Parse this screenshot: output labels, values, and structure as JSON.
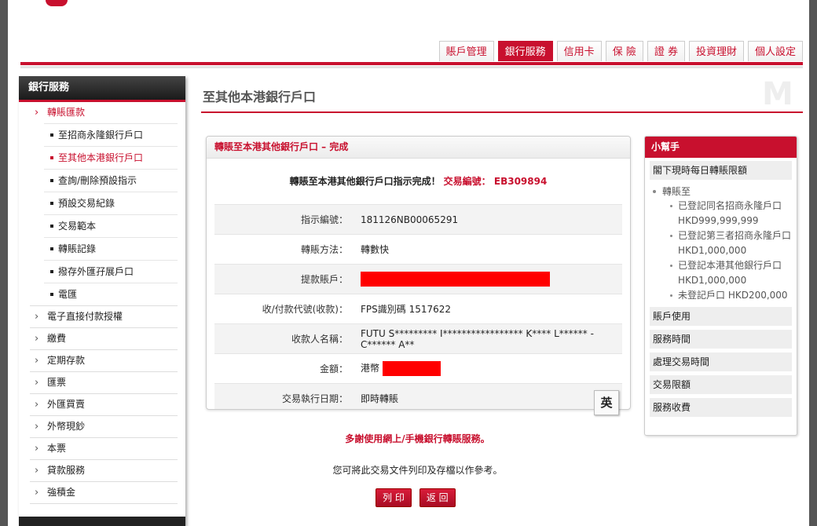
{
  "tabs": [
    "賬戶管理",
    "銀行服務",
    "信用卡",
    "保 險",
    "證 券",
    "投資理財",
    "個人設定"
  ],
  "sidebar": {
    "title": "銀行服務",
    "items": [
      {
        "label": "轉賬匯款",
        "sub": [
          "至招商永隆銀行戶口",
          "至其他本港銀行戶口",
          "查詢/刪除預設指示",
          "預設交易紀錄",
          "交易範本",
          "轉賬記錄",
          "撥存外匯孖展戶口",
          "電匯"
        ]
      },
      {
        "label": "電子直接付款授權"
      },
      {
        "label": "繳費"
      },
      {
        "label": "定期存款"
      },
      {
        "label": "匯票"
      },
      {
        "label": "外匯買賣"
      },
      {
        "label": "外幣現鈔"
      },
      {
        "label": "本票"
      },
      {
        "label": "貸款服務"
      },
      {
        "label": "強積金"
      }
    ]
  },
  "page_title": "至其他本港銀行戶口",
  "panel": {
    "title": "轉賬至本港其他銀行戶口 – 完成",
    "confirm_text": "轉賬至本港其他銀行戶口指示完成！",
    "ref_label": "交易編號：",
    "ref_value": "EB309894",
    "rows": [
      {
        "label": "指示編號：",
        "value": "181126NB00065291"
      },
      {
        "label": "轉賬方法：",
        "value": "轉數快"
      },
      {
        "label": "提款賬戶：",
        "value": ""
      },
      {
        "label": "收/付款代號(收款)：",
        "value": "FPS識別碼 1517622"
      },
      {
        "label": "收款人名稱：",
        "value": "FUTU S********* I***************** K**** L****** - C****** A**"
      },
      {
        "label": "金額：",
        "value": "港幣"
      },
      {
        "label": "交易執行日期：",
        "value": "即時轉賬"
      }
    ]
  },
  "ime_label": "英",
  "thanks": "多謝使用網上/手機銀行轉賬服務。",
  "note": "您可將此交易文件列印及存檔以作參考。",
  "buttons": {
    "print": "列 印",
    "back": "返 回"
  },
  "helper": {
    "title": "小幫手",
    "section": "閣下現時每日轉賬限額",
    "limits_head": "轉賬至",
    "limits": [
      "已登記同名招商永隆戶口 HKD999,999,999",
      "已登記第三者招商永隆戶口 HKD1,000,000",
      "已登記本港其他銀行戶口 HKD1,000,000",
      "未登記戶口 HKD200,000"
    ],
    "links": [
      "賬戶使用",
      "服務時間",
      "處理交易時間",
      "交易限額",
      "服務收費"
    ]
  },
  "colors": {
    "brand": "#c8102e",
    "redaction": "#ff0000"
  }
}
